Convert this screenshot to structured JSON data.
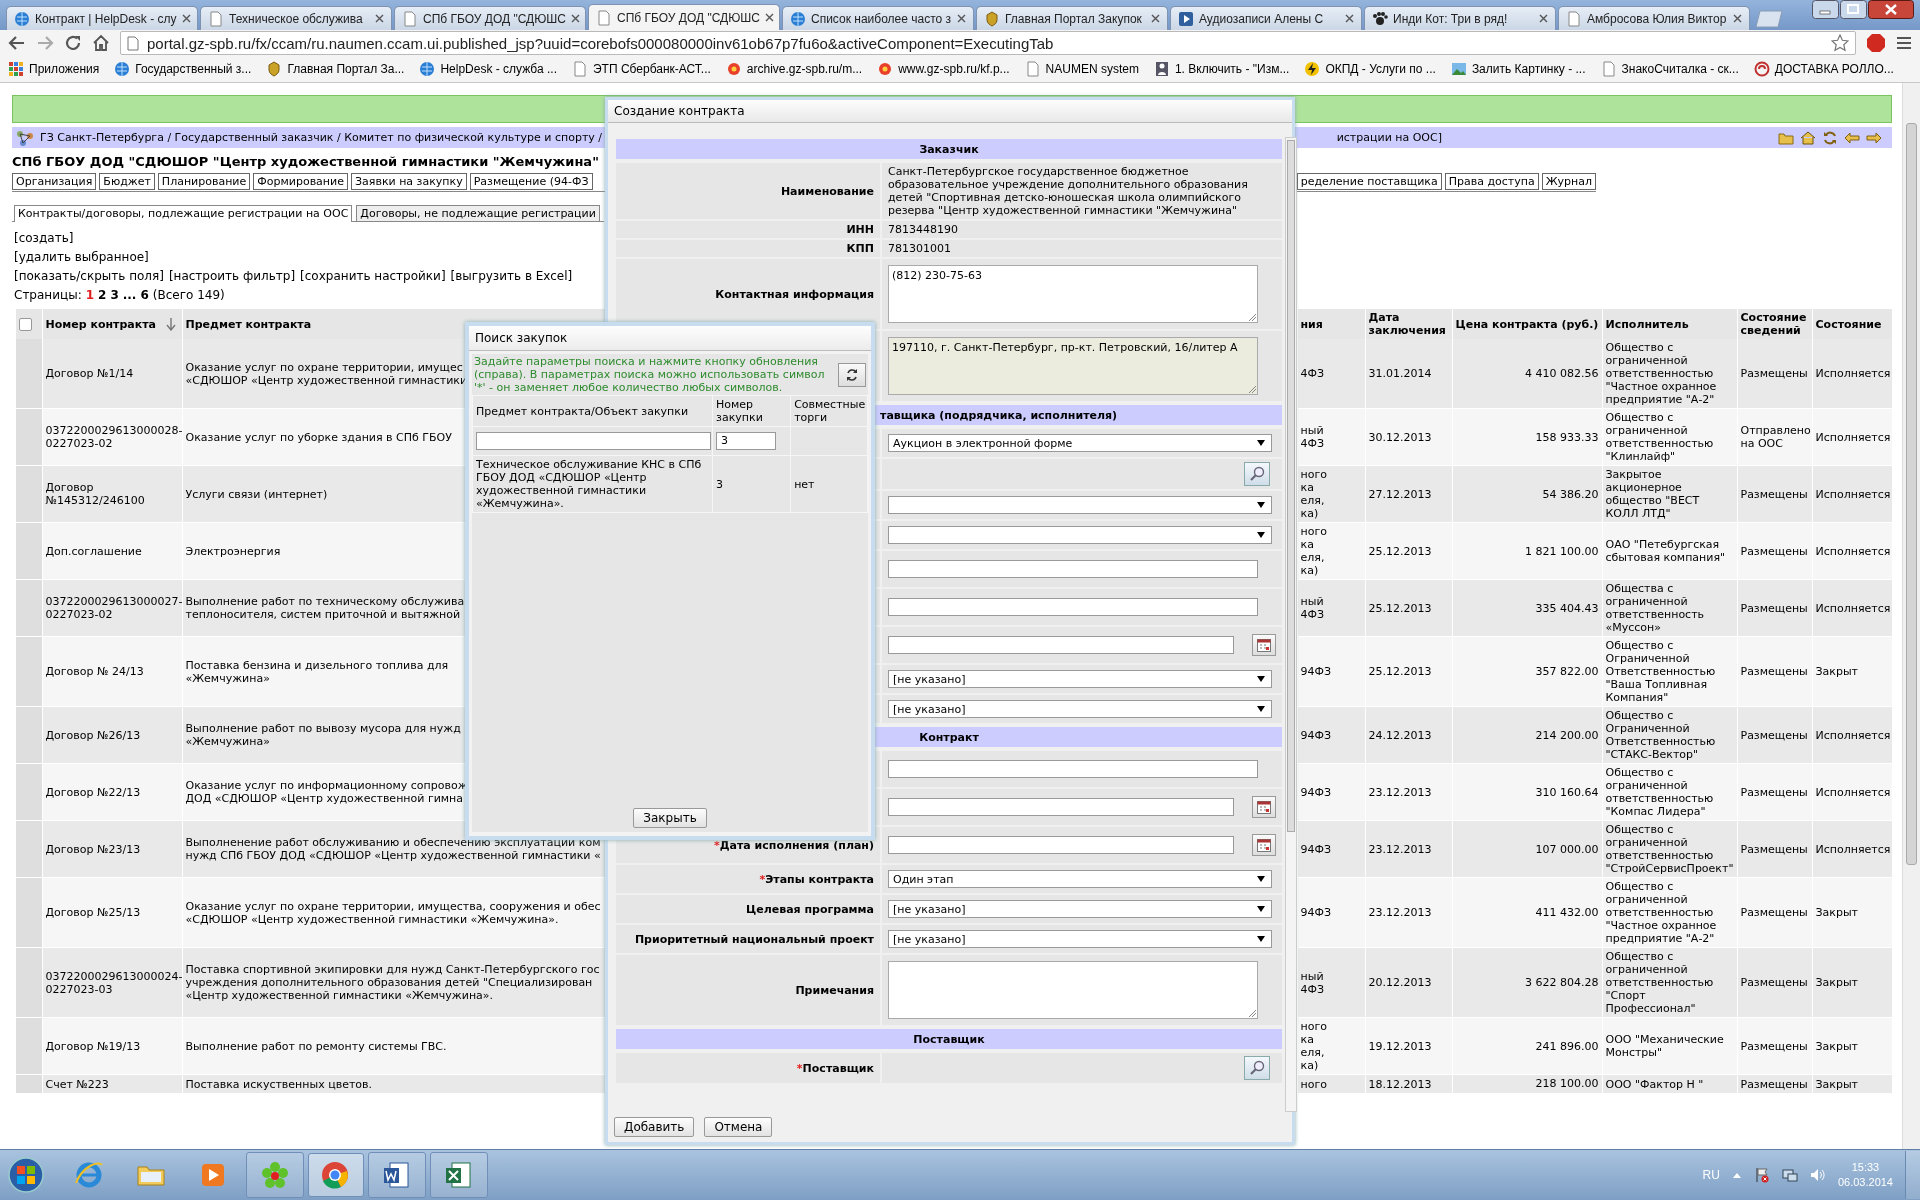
{
  "browser": {
    "tabs": [
      {
        "title": "Контракт | HelpDesk - слу",
        "selected": false
      },
      {
        "title": "Техническое обслужива",
        "selected": false
      },
      {
        "title": "СПб ГБОУ ДОД \"СДЮШС",
        "selected": false
      },
      {
        "title": "СПб ГБОУ ДОД \"СДЮШС",
        "selected": true
      },
      {
        "title": "Список наиболее часто з",
        "selected": false
      },
      {
        "title": "Главная Портал Закупок",
        "selected": false
      },
      {
        "title": "Аудиозаписи Алены С",
        "selected": false
      },
      {
        "title": "Инди Кот: Три в ряд!",
        "selected": false
      },
      {
        "title": "Амбросова Юлия Виктор",
        "selected": false
      }
    ],
    "address": "portal.gz-spb.ru/fx/ccam/ru.naumen.ccam.ui.published_jsp?uuid=corebofs000080000inv61ob67p7fu6o&activeComponent=ExecutingTab",
    "bookmarks": [
      "Приложения",
      "Государственный з...",
      "Главная Портал За...",
      "HelpDesk - служба ...",
      "ЭТП Сбербанк-АСТ...",
      "archive.gz-spb.ru/m...",
      "www.gz-spb.ru/kf.p...",
      "NAUMEN system",
      "1. Включить - \"Изм...",
      "ОКПД - Услуги по ...",
      "Залить Картинку - ...",
      "ЗнакоСчиталка - ск...",
      "ДОСТАВКА РОЛЛО..."
    ]
  },
  "page": {
    "breadcrumb": "ГЗ Санкт-Петербурга / Государственный заказчик / Комитет по физической культуре и спорту /",
    "breadcrumb_tail": "истрации на ООС]",
    "title": "СПб ГБОУ ДОД \"СДЮШОР \"Центр художественной гимнастики \"Жемчужина\"",
    "nav_tabs_left": [
      "Организация",
      "Бюджет",
      "Планирование",
      "Формирование",
      "Заявки на закупку",
      "Размещение (94-ФЗ"
    ],
    "nav_tabs_right": [
      "ределение поставщика",
      "Права доступа",
      "Журнал"
    ],
    "sub_tabs": [
      {
        "label": "Контракты/договоры, подлежащие регистрации на ООС",
        "selected": true
      },
      {
        "label": "Договоры, не подлежащие регистрации",
        "selected": false
      }
    ],
    "actions": [
      "[создать]",
      "[удалить выбранное]"
    ],
    "actions_row": [
      "[показать/скрыть поля]",
      "[настроить фильтр]",
      "[сохранить настройки]",
      "[выгрузить в Excel]"
    ],
    "pager": {
      "label": "Страницы:",
      "pages": [
        {
          "label": "1",
          "selected": true
        },
        {
          "label": "2",
          "selected": false
        },
        {
          "label": "3",
          "selected": false
        }
      ],
      "ellipsis": "...",
      "last": "6",
      "total": "(Всего 149)"
    }
  },
  "table": {
    "select_all": {
      "checked": false
    },
    "columns": [
      "Номер контракта",
      "Предмет контракта",
      "ния",
      "Дата заключения",
      "Цена контракта (руб.)",
      "Исполнитель",
      "Состояние сведений",
      "Состояние"
    ],
    "rows": [
      {
        "number": "Договор №1/14",
        "subject": "Оказание услуг по охране территории, имущес\n«СДЮШОР «Центр художественной гимнастики",
        "column_3": "4ФЗ",
        "date": "31.01.2014",
        "price": "4 410 082.56",
        "executor": "Общество с ограниченной ответственностью \"Частное охранное предприятие \"А-2\"",
        "info_state": "Размещены",
        "state": "Исполняется"
      },
      {
        "number": "0372200029613000028-0227023-02",
        "subject": "Оказание услуг по уборке здания в СПб ГБОУ",
        "column_3": "ный\n4ФЗ",
        "date": "30.12.2013",
        "price": "158 933.33",
        "executor": "Общество с ограниченной ответственностью \"Клинлайф\"",
        "info_state": "Отправлено на ООС",
        "state": "Исполняется"
      },
      {
        "number": "Договор №145312/246100",
        "subject": "Услуги связи (интернет)",
        "column_3": "ного\nка\nеля,\nка)",
        "date": "27.12.2013",
        "price": "54 386.20",
        "executor": "Закрытое акционерное общество \"ВЕСТ КОЛЛ ЛТД\"",
        "info_state": "Размещены",
        "state": "Исполняется"
      },
      {
        "number": "Доп.соглашение",
        "subject": "Электроэнергия",
        "column_3": "ного\nка\nеля,\nка)",
        "date": "25.12.2013",
        "price": "1 821 100.00",
        "executor": "ОАО \"Петебургская сбытовая компания\"",
        "info_state": "Размещены",
        "state": "Исполняется"
      },
      {
        "number": "0372200029613000027-0227023-02",
        "subject": "Выполнение работ по техническому обслужива\nтеплоносителя, систем приточной и вытяжной",
        "column_3": "ный\n4ФЗ",
        "date": "25.12.2013",
        "price": "335 404.43",
        "executor": "Общества с ограниченной ответственность «Муссон»",
        "info_state": "Размещены",
        "state": "Исполняется"
      },
      {
        "number": "Договор № 24/13",
        "subject": "Поставка бензина и дизельного топлива для\n«Жемчужина»",
        "column_3": "94ФЗ",
        "date": "25.12.2013",
        "price": "357 822.00",
        "executor": "Общество с Ограниченной Ответственностью \"Ваша Топливная Компания\"",
        "info_state": "Размещены",
        "state": "Закрыт"
      },
      {
        "number": "Договор №26/13",
        "subject": "Выполнение работ по вывозу мусора для нужд\n«Жемчужина»",
        "column_3": "94ФЗ",
        "date": "24.12.2013",
        "price": "214 200.00",
        "executor": "Общество с Ограниченной Ответственностью \"СТАКС-Вектор\"",
        "info_state": "Размещены",
        "state": "Исполняется"
      },
      {
        "number": "Договор №22/13",
        "subject": "Оказание услуг по информационному сопровож\nДОД «СДЮШОР «Центр художественной гимна",
        "column_3": "94ФЗ",
        "date": "23.12.2013",
        "price": "310 160.64",
        "executor": "Общество с ограниченной ответственностью \"Компас Лидера\"",
        "info_state": "Размещены",
        "state": "Исполняется"
      },
      {
        "number": "Договор №23/13",
        "subject": "Выполненение работ обслуживанию и обеспечению эксплуатации ком\nнужд СПб ГБОУ ДОД «СДЮШОР «Центр художественной гимнастики «",
        "column_3": "94ФЗ",
        "date": "23.12.2013",
        "price": "107 000.00",
        "executor": "Общество с ограниченной ответственностью \"СтройСервисПроект\"",
        "info_state": "Размещены",
        "state": "Исполняется"
      },
      {
        "number": "Договор №25/13",
        "subject": "Оказание услуг по охране территории, имущества, сооружения и обес\n«СДЮШОР «Центр художественной гимнастики «Жемчужина».",
        "column_3": "94ФЗ",
        "date": "23.12.2013",
        "price": "411 432.00",
        "executor": "Общество с ограниченной ответственностью \"Частное охранное предприятие \"А-2\"",
        "info_state": "Размещены",
        "state": "Закрыт"
      },
      {
        "number": "0372200029613000024-0227023-03",
        "subject": "Поставка спортивной экипировки для нужд Санкт-Петербургского гос\nучреждения дополнительного образования детей \"Специализирован\n«Центр художественной гимнастики «Жемчужина».",
        "column_3": "ный\n4ФЗ",
        "date": "20.12.2013",
        "price": "3 622 804.28",
        "executor": "Общество с ограниченной ответственностью \"Спорт Профессионал\"",
        "info_state": "Размещены",
        "state": "Закрыт"
      },
      {
        "number": "Договор №19/13",
        "subject": "Выполнение работ по ремонту системы ГВС.",
        "column_3": "ного\nка\nеля,\nка)",
        "date": "19.12.2013",
        "price": "241 896.00",
        "executor": "ООО \"Механические Монстры\"",
        "info_state": "Размещены",
        "state": "Закрыт"
      },
      {
        "number": "Счет №223",
        "subject": "Поставка искуственных цветов.",
        "column_3": "ного",
        "date": "18.12.2013",
        "price": "218 100.00",
        "executor": "ООО \"Фактор Н \"",
        "info_state": "Размещены",
        "state": "Закрыт"
      }
    ]
  },
  "contract_dialog": {
    "title": "Создание контракта",
    "rows": [
      {
        "kind": "section",
        "text": "Заказчик",
        "partial": false
      },
      {
        "kind": "text",
        "label": "Наименование",
        "value": "Санкт-Петербургское государственное бюджетное образовательное учреждение дополнительного образования детей \"Спортивная детско-юношеская школа олимпийского резерва \"Центр художественной гимнастики \"Жемчужина\""
      },
      {
        "kind": "text",
        "label": "ИНН",
        "value": "7813448190"
      },
      {
        "kind": "text",
        "label": "КПП",
        "value": "781301001"
      },
      {
        "kind": "textarea",
        "label": "Контактная информация",
        "value": "(812) 230-75-63",
        "disabled": false
      },
      {
        "kind": "textarea",
        "value": "197110, г. Санкт-Петербург, пр-кт. Петровский, 16/литер А",
        "disabled": true
      },
      {
        "kind": "section",
        "text": "тавщика (подрядчика, исполнителя)",
        "partial": true
      },
      {
        "kind": "select",
        "value": "Аукцион в электронной форме"
      },
      {
        "kind": "search"
      },
      {
        "kind": "select"
      },
      {
        "kind": "select"
      },
      {
        "kind": "input"
      },
      {
        "kind": "input"
      },
      {
        "kind": "date"
      },
      {
        "kind": "select",
        "value": "[не указано]"
      },
      {
        "kind": "select",
        "value": "[не указано]"
      },
      {
        "kind": "section",
        "text": "Контракт",
        "partial": false
      },
      {
        "kind": "input"
      },
      {
        "kind": "date"
      },
      {
        "kind": "date",
        "label": "Дата исполнения (план)",
        "mark": "*"
      },
      {
        "kind": "select",
        "label": "Этапы контракта",
        "mark": "*",
        "value": "Один этап"
      },
      {
        "kind": "select",
        "label": "Целевая программа",
        "value": "[не указано]"
      },
      {
        "kind": "select",
        "label": "Приоритетный национальный проект",
        "value": "[не указано]"
      },
      {
        "kind": "textarea",
        "label": "Примечания",
        "disabled": false
      },
      {
        "kind": "section",
        "text": "Поставщик",
        "partial": false
      },
      {
        "kind": "search",
        "label": "Поставщик",
        "mark": "*"
      }
    ],
    "buttons": [
      "Добавить",
      "Отмена"
    ]
  },
  "search_dialog": {
    "title": "Поиск закупок",
    "hint": "Задайте параметры поиска и нажмите кнопку обновления (справа). В параметрах поиска можно использовать символ '*' - он заменяет любое количество любых символов.",
    "columns": [
      "Предмет контракта/Объект закупки",
      "Номер закупки",
      "Совместные торги"
    ],
    "filters": {
      "number": "3"
    },
    "rows": [
      {
        "subject": "Техническое обслуживание КНС в СПб ГБОУ ДОД «СДЮШОР «Центр художественной гимнастики «Жемчужина».",
        "number": "3",
        "joint": "нет"
      }
    ],
    "close": "Закрыть"
  },
  "taskbar": {
    "apps": [
      {
        "kind": "ie",
        "running": false,
        "selected": false
      },
      {
        "kind": "folder",
        "running": false,
        "selected": false
      },
      {
        "kind": "player",
        "running": false,
        "selected": false
      },
      {
        "kind": "flower",
        "running": true,
        "selected": false
      },
      {
        "kind": "chrome",
        "running": true,
        "selected": true
      },
      {
        "kind": "word",
        "running": true,
        "selected": false
      },
      {
        "kind": "excel",
        "running": true,
        "selected": false
      }
    ],
    "language": "RU",
    "time": "15:33",
    "date": "06.03.2014"
  }
}
